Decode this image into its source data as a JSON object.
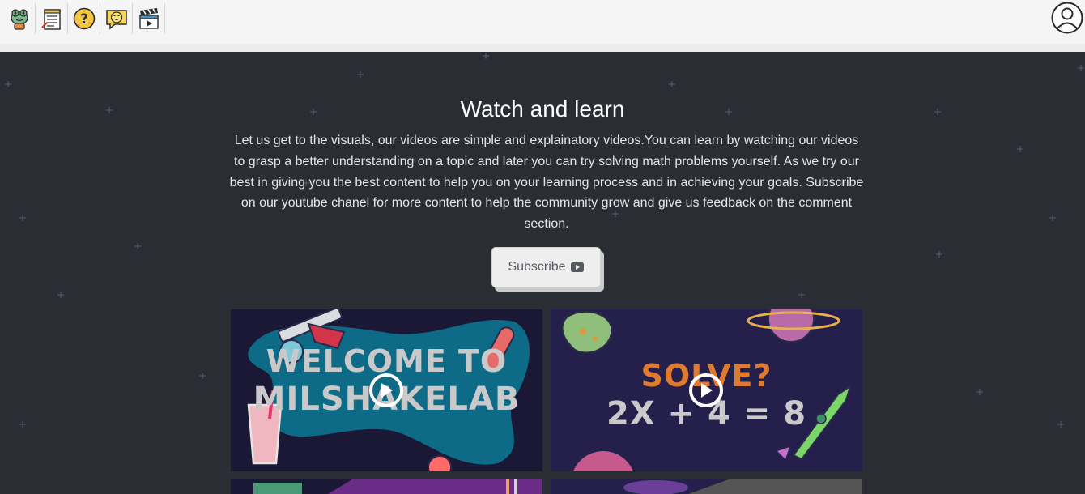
{
  "nav": {
    "icons": [
      "frog-mascot-icon",
      "notepad-icon",
      "question-icon",
      "smiley-chat-icon",
      "clapperboard-icon"
    ],
    "avatar_icon": "user-avatar-icon"
  },
  "hero": {
    "title": "Watch and learn",
    "description": "Let us get to the visuals, our videos are simple and explainatory videos.You can learn by watching our videos to grasp a better understanding on a topic and later you can try solving math problems yourself. As we try our best in giving you the best content to help you on your learning process and in achieving your goals. Subscribe on our youtube chanel for more content to help the community grow and give us feedback on the comment section.",
    "subscribe_label": "Subscribe",
    "subscribe_icon": "youtube-play-icon"
  },
  "videos": [
    {
      "line1": "WELCOME TO",
      "line2": "MILSHAKELAB",
      "play_icon": "play-icon"
    },
    {
      "line1": "SOLVE?",
      "line2": "2X + 4 = 8",
      "play_icon": "play-icon"
    }
  ],
  "colors": {
    "background": "#2a2d34",
    "nav_background": "#f5f5f5",
    "solve_orange": "#e07a2e",
    "thumb_text_grey": "#c9c9c9"
  }
}
